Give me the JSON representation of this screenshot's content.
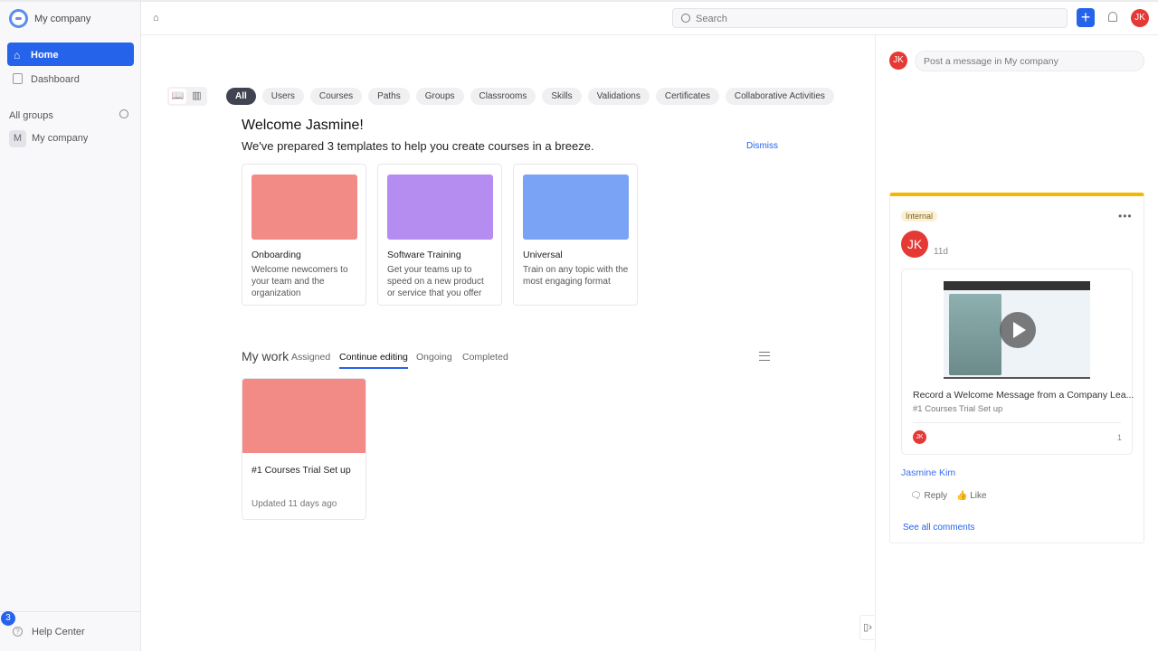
{
  "sidebar": {
    "company": "My company",
    "nav": [
      {
        "label": "Home",
        "icon": "home-icon"
      },
      {
        "label": "Dashboard",
        "icon": "dashboard-icon"
      }
    ],
    "groups_title": "All groups",
    "groups": [
      {
        "initial": "M",
        "label": "My company"
      }
    ],
    "help_badge": "3",
    "help_label": "Help Center"
  },
  "topbar": {
    "search_placeholder": "Search",
    "user_initials": "JK"
  },
  "main": {
    "filters": [
      "All",
      "Users",
      "Courses",
      "Paths",
      "Groups",
      "Classrooms",
      "Skills",
      "Validations",
      "Certificates",
      "Collaborative Activities"
    ],
    "welcome_title": "Welcome Jasmine!",
    "welcome_sub": "We've prepared 3 templates to help you create courses in a breeze.",
    "dismiss": "Dismiss",
    "templates": [
      {
        "title": "Onboarding",
        "desc": "Welcome newcomers to your team and the organization",
        "color": "#f28b85"
      },
      {
        "title": "Software Training",
        "desc": "Get your teams up to speed on a new product or service that you offer",
        "color": "#b58cf0"
      },
      {
        "title": "Universal",
        "desc": "Train on any topic with the most engaging format",
        "color": "#7aa2f5"
      }
    ],
    "mywork": {
      "title": "My work",
      "tabs": [
        "Assigned",
        "Continue editing",
        "Ongoing",
        "Completed"
      ],
      "active_tab": "Continue editing",
      "cards": [
        {
          "title": "#1 Courses Trial Set up",
          "updated": "Updated 11 days ago"
        }
      ]
    }
  },
  "right": {
    "post_placeholder": "Post a message in My company",
    "feed": {
      "badge": "Internal",
      "initials": "JK",
      "time": "11d",
      "video_title": "Record a Welcome Message from a Company Lea...",
      "video_sub": "#1 Courses Trial Set up",
      "count": "1",
      "author": "Jasmine Kim",
      "reply": "Reply",
      "like": "Like",
      "see_all": "See all comments"
    }
  },
  "colors": {
    "accent": "#2563eb",
    "avatar": "#e53935",
    "feed_top": "#f5b800"
  }
}
